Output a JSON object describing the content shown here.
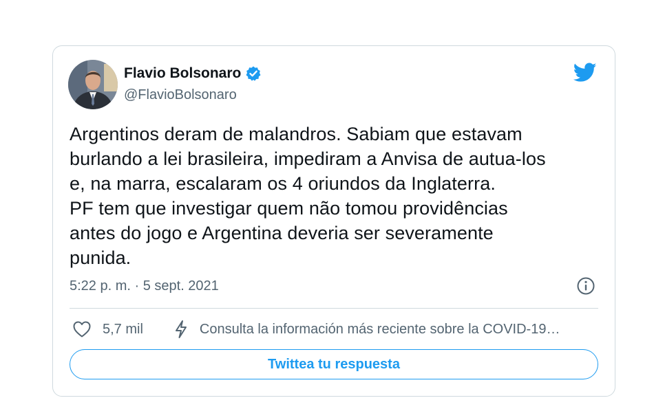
{
  "tweet": {
    "author": {
      "display_name": "Flavio Bolsonaro",
      "handle": "@FlavioBolsonaro",
      "verified": true
    },
    "text": "Argentinos deram de malandros. Sabiam que estavam\nburlando a lei brasileira, impediram a Anvisa de autua-los\ne, na marra, escalaram os 4 oriundos da Inglaterra.\nPF tem que investigar quem não tomou providências\nantes do jogo e Argentina deveria ser severamente\npunida.",
    "timestamp": "5:22 p. m. · 5 sept. 2021",
    "likes": "5,7 mil",
    "covid_notice": "Consulta la información más reciente sobre la COVID-19…",
    "reply_label": "Twittea tu respuesta"
  },
  "icons": {
    "verified": "verified-badge-icon",
    "bird": "twitter-bird-icon",
    "info": "info-icon",
    "like": "heart-icon",
    "lightning": "lightning-bolt-icon"
  },
  "colors": {
    "accent": "#1d9bf0",
    "text": "#0f1419",
    "secondary_text": "#536471",
    "border": "#cfd9de"
  }
}
